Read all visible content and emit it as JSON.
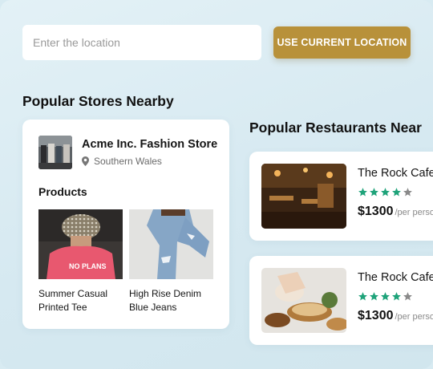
{
  "search": {
    "placeholder": "Enter the location",
    "use_location_label": "USE CURRENT LOCATION"
  },
  "stores_section": {
    "title": "Popular Stores Nearby",
    "store": {
      "name": "Acme Inc. Fashion Store",
      "location": "Southern Wales",
      "products_title": "Products",
      "products": [
        {
          "line1": "Summer Casual",
          "line2": "Printed Tee"
        },
        {
          "line1": "High Rise Denim",
          "line2": "Blue Jeans"
        }
      ]
    }
  },
  "restaurants_section": {
    "title": "Popular Restaurants Near",
    "restaurants": [
      {
        "name": "The Rock Cafe",
        "rating": 4,
        "max_rating": 5,
        "price": "$1300",
        "per": "/per person"
      },
      {
        "name": "The Rock Cafe",
        "rating": 4,
        "max_rating": 5,
        "price": "$1300",
        "per": "/per person"
      }
    ]
  },
  "colors": {
    "accent": "#b8913a",
    "background": "#d8ebf2",
    "star_filled": "#1fa37a",
    "star_empty": "#8a8a8a"
  }
}
